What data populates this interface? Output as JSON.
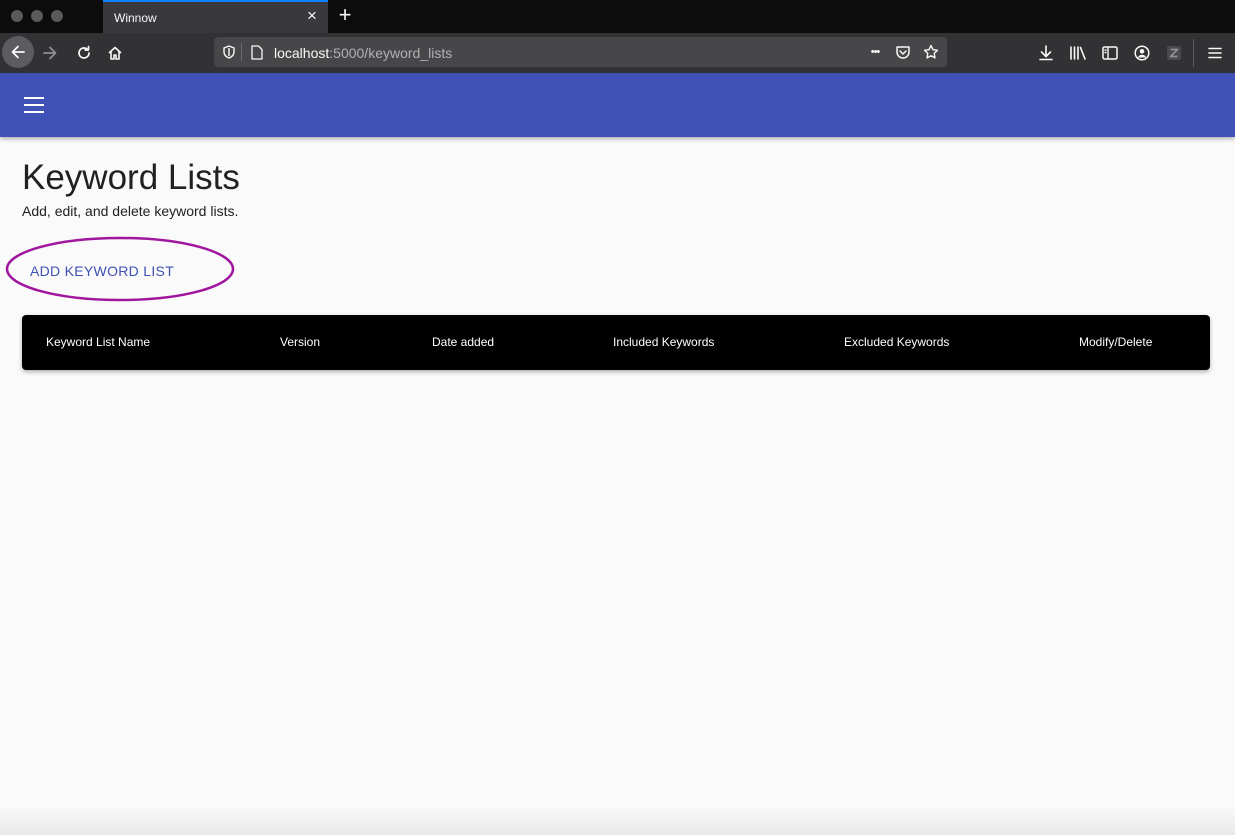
{
  "browser": {
    "tab_title": "Winnow",
    "tab_close_icon": "×",
    "new_tab_icon": "+",
    "url_host": "localhost",
    "url_rest": ":5000/keyword_lists",
    "url_more_icon": "•••",
    "colors": {
      "tabbar": "#0c0c0d",
      "tab_active": "#38383d",
      "toolbar": "#323234"
    }
  },
  "app": {
    "header_color": "#3f51b5",
    "menu_icon": "hamburger-menu-icon"
  },
  "page": {
    "title": "Keyword Lists",
    "subtitle": "Add, edit, and delete keyword lists.",
    "add_button_label": "ADD KEYWORD LIST",
    "annotation_color": "#a0179e"
  },
  "table": {
    "columns": [
      "Keyword List Name",
      "Version",
      "Date added",
      "Included Keywords",
      "Excluded Keywords",
      "Modify/Delete"
    ],
    "rows": []
  }
}
